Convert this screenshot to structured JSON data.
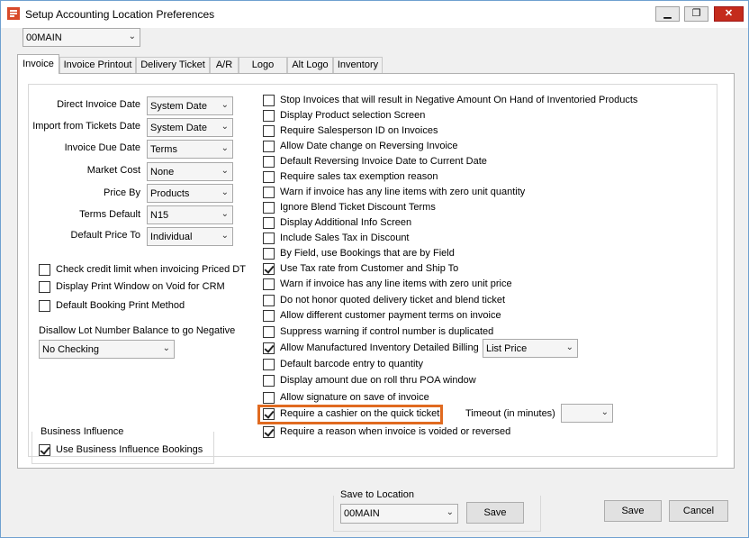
{
  "window": {
    "title": "Setup Accounting Location Preferences"
  },
  "location_select": {
    "value": "00MAIN"
  },
  "tabs": [
    {
      "label": "Invoice"
    },
    {
      "label": "Invoice Printout"
    },
    {
      "label": "Delivery Ticket"
    },
    {
      "label": "A/R"
    },
    {
      "label": "Logo"
    },
    {
      "label": "Alt Logo"
    },
    {
      "label": "Inventory"
    }
  ],
  "left_fields": [
    {
      "label": "Direct Invoice Date",
      "value": "System Date"
    },
    {
      "label": "Import from Tickets Date",
      "value": "System Date"
    },
    {
      "label": "Invoice Due Date",
      "value": "Terms"
    },
    {
      "label": "Market Cost",
      "value": "None"
    },
    {
      "label": "Price By",
      "value": "Products"
    },
    {
      "label": "Terms Default",
      "value": "N15"
    },
    {
      "label": "Default Price To",
      "value": "Individual"
    }
  ],
  "left_checks": [
    {
      "label": "Check credit limit when invoicing Priced DT",
      "checked": false
    },
    {
      "label": "Display Print Window on Void for CRM",
      "checked": false
    },
    {
      "label": "Default Booking Print Method",
      "checked": false
    }
  ],
  "lot_number": {
    "label": "Disallow Lot Number Balance to go Negative",
    "value": "No Checking"
  },
  "business_influence": {
    "title": "Business Influence",
    "label": "Use Business Influence Bookings",
    "checked": true
  },
  "right_checks": [
    {
      "label": "Stop Invoices that will result in Negative Amount On Hand of Inventoried Products",
      "checked": false
    },
    {
      "label": "Display Product selection Screen",
      "checked": false
    },
    {
      "label": "Require Salesperson ID on Invoices",
      "checked": false
    },
    {
      "label": "Allow Date change on Reversing Invoice",
      "checked": false
    },
    {
      "label": "Default Reversing Invoice Date to Current Date",
      "checked": false
    },
    {
      "label": "Require sales tax exemption reason",
      "checked": false
    },
    {
      "label": "Warn if invoice has any line items with zero unit quantity",
      "checked": false
    },
    {
      "label": "Ignore Blend Ticket Discount Terms",
      "checked": false
    },
    {
      "label": "Display Additional Info Screen",
      "checked": false
    },
    {
      "label": "Include Sales Tax in Discount",
      "checked": false
    },
    {
      "label": "By Field, use Bookings that are by Field",
      "checked": false
    },
    {
      "label": "Use Tax rate from Customer and Ship To",
      "checked": true
    },
    {
      "label": "Warn if invoice has any line items with zero unit price",
      "checked": false
    },
    {
      "label": "Do not honor quoted delivery ticket and blend ticket",
      "checked": false
    },
    {
      "label": "Allow different customer payment terms on invoice",
      "checked": false
    },
    {
      "label": "Suppress warning if control number is duplicated",
      "checked": false
    },
    {
      "label": "Allow Manufactured Inventory Detailed Billing",
      "checked": true
    },
    {
      "label": "Default barcode entry to quantity",
      "checked": false
    },
    {
      "label": "Display amount due on roll thru POA window",
      "checked": false
    },
    {
      "label": "Allow signature on save of invoice",
      "checked": false
    },
    {
      "label": "Require a cashier on the quick ticket",
      "checked": true
    },
    {
      "label": "Require a reason when invoice is voided or reversed",
      "checked": true
    }
  ],
  "billing_price": {
    "value": "List Price"
  },
  "timeout": {
    "label": "Timeout (in minutes)",
    "value": ""
  },
  "save_to_location": {
    "title": "Save to Location",
    "value": "00MAIN",
    "save_label": "Save"
  },
  "footer": {
    "save_label": "Save",
    "cancel_label": "Cancel"
  }
}
